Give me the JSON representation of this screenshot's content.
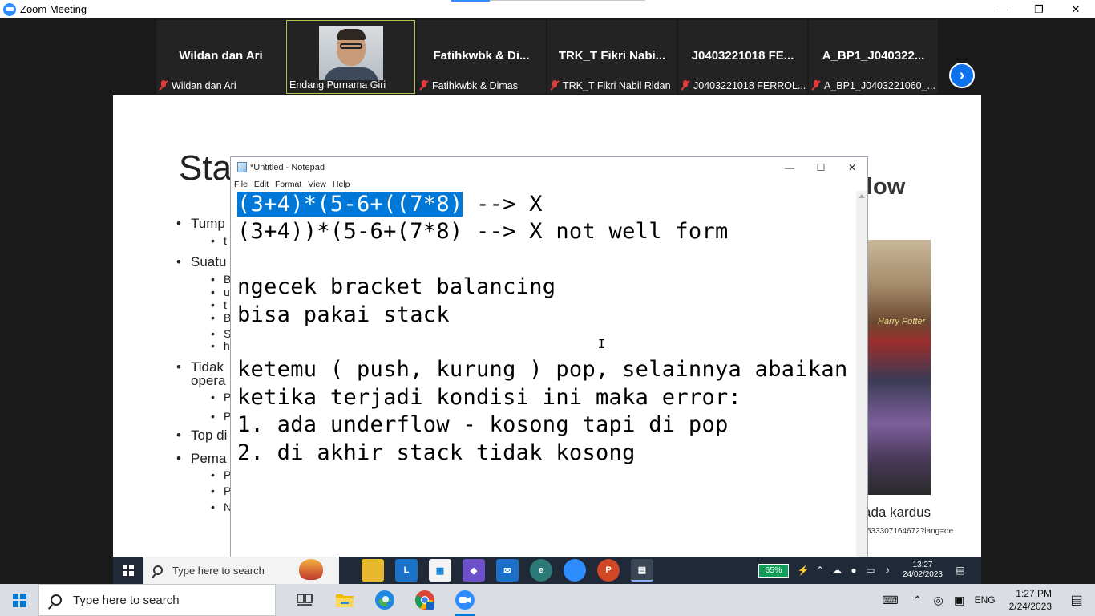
{
  "zoom": {
    "title": "Zoom Meeting",
    "controls": {
      "minimize": "—",
      "restore": "❐",
      "close": "✕"
    },
    "next_label": "›",
    "participants": [
      {
        "name": "Wildan dan Ari",
        "caption": "Wildan dan Ari",
        "muted": true,
        "has_video": false
      },
      {
        "name": "",
        "caption": "Endang Purnama Giri",
        "muted": false,
        "has_video": true
      },
      {
        "name": "Fatihkwbk & Di...",
        "caption": "Fatihkwbk & Dimas",
        "muted": true,
        "has_video": false
      },
      {
        "name": "TRK_T Fikri Nabi...",
        "caption": "TRK_T Fikri Nabil Ridan",
        "muted": true,
        "has_video": false
      },
      {
        "name": "J0403221018 FE...",
        "caption": "J0403221018 FERROL...",
        "muted": true,
        "has_video": false
      },
      {
        "name": "A_BP1_J040322...",
        "caption": "A_BP1_J0403221060_...",
        "muted": true,
        "has_video": false
      }
    ]
  },
  "slide": {
    "title": "Sta",
    "right_title": "low",
    "bullets": [
      {
        "text": "Tump",
        "level": 1
      },
      {
        "text": "t",
        "level": 2
      },
      {
        "text": "Suatu",
        "level": 1
      },
      {
        "text": "B",
        "level": 2
      },
      {
        "text": "u",
        "level": 3
      },
      {
        "text": "t",
        "level": 3
      },
      {
        "text": "B",
        "level": 2
      },
      {
        "text": "S",
        "level": 2
      },
      {
        "text": "h",
        "level": 3
      },
      {
        "text": "Tidak",
        "level": 1
      },
      {
        "text": "opera",
        "level": 3
      },
      {
        "text": "P",
        "level": 2
      },
      {
        "text": "P",
        "level": 2
      },
      {
        "text": "Top di",
        "level": 1
      },
      {
        "text": "Pema",
        "level": 1
      },
      {
        "text": "P",
        "level": 2
      },
      {
        "text": "P",
        "level": 2
      },
      {
        "text": "N",
        "level": 2
      }
    ],
    "image_text": "Harry Potter",
    "caption": "ada kardus",
    "url": "533307164672?lang=de"
  },
  "notepad": {
    "title": "*Untitled - Notepad",
    "menu": [
      "File",
      "Edit",
      "Format",
      "View",
      "Help"
    ],
    "controls": {
      "minimize": "—",
      "maximize": "☐",
      "close": "✕"
    },
    "selected_text": "(3+4)*(5-6+((7*8)",
    "line1_rest": " --> X",
    "lines": [
      "(3+4))*(5-6+(7*8) --> X not well form",
      "",
      "ngecek bracket balancing",
      "bisa pakai stack",
      "",
      "ketemu ( push, kurung ) pop, selainnya abaikan",
      "ketika terjadi kondisi ini maka error:",
      "1. ada underflow - kosong tapi di pop",
      "2. di akhir stack tidak kosong"
    ]
  },
  "remote_taskbar": {
    "search_placeholder": "Type here to search",
    "battery": "65%",
    "time": "13:27",
    "date": "24/02/2023",
    "apps": [
      "file-explorer",
      "linkedin",
      "store",
      "photos",
      "mail",
      "edge",
      "zoom",
      "powerpoint",
      "notepad"
    ]
  },
  "local_taskbar": {
    "search_placeholder": "Type here to search",
    "lang": "ENG",
    "time": "1:27 PM",
    "date": "2/24/2023",
    "apps": [
      "task-view",
      "file-explorer",
      "edge",
      "chrome",
      "zoom"
    ]
  },
  "colors": {
    "zoom_blue": "#2d8cff",
    "selection": "#0078d7",
    "active_tile_border": "#b6c34c",
    "mute_red": "#e23b3b"
  }
}
